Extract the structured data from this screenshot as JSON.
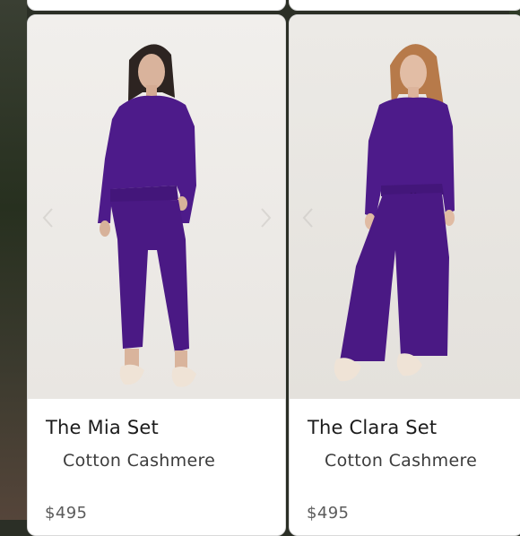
{
  "products": [
    {
      "name": "The Mia Set",
      "material": "Cotton Cashmere",
      "price": "$495"
    },
    {
      "name": "The Clara Set",
      "material": "Cotton Cashmere",
      "price": "$495"
    }
  ],
  "colors": {
    "garment": "#4d1b8a",
    "card_background": "#ffffff",
    "photo_background": "#efedea"
  },
  "icons": [
    "chevron-left-icon",
    "chevron-right-icon"
  ]
}
